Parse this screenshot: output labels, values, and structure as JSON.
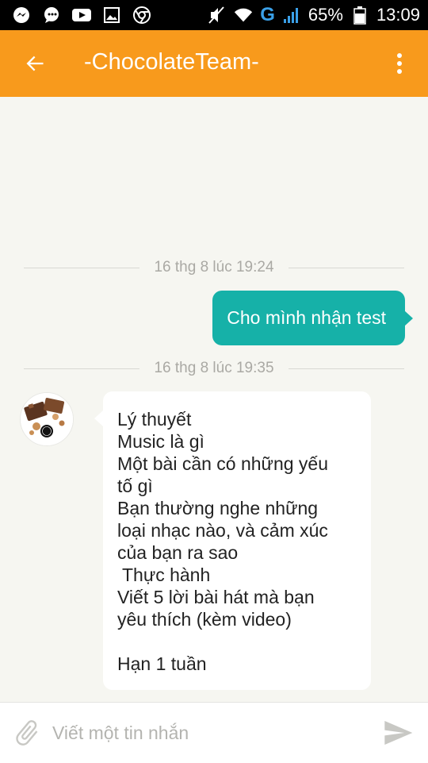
{
  "status_bar": {
    "left_icons": [
      "messenger-icon",
      "chat-bubble-icon",
      "youtube-icon",
      "image-icon",
      "chrome-icon"
    ],
    "signal_label": "G",
    "battery_percent": "65%",
    "time": "13:09"
  },
  "toolbar": {
    "title": "-ChocolateTeam-",
    "back_icon": "arrow-back-icon",
    "menu_icon": "more-vert-icon"
  },
  "chat": {
    "separators": [
      "16 thg 8 lúc 19:24",
      "16 thg 8 lúc 19:35"
    ],
    "outgoing_message": "Cho mình nhận test",
    "incoming_lines": [
      "Lý thuyết",
      "Music là gì",
      "Một bài cần có những yếu",
      "tố gì",
      "Bạn thường nghe những",
      "loại nhạc nào, và cảm xúc",
      "của bạn ra sao",
      " Thực hành",
      "Viết 5 lời bài hát mà bạn",
      "yêu thích (kèm video)",
      "",
      "Hạn 1 tuần"
    ]
  },
  "input_bar": {
    "placeholder": "Viết một tin nhắn",
    "attach_icon": "paperclip-icon",
    "send_icon": "send-icon"
  },
  "colors": {
    "toolbar": "#f89a1c",
    "outgoing_bubble": "#16b1a8",
    "background": "#f6f6f1"
  }
}
